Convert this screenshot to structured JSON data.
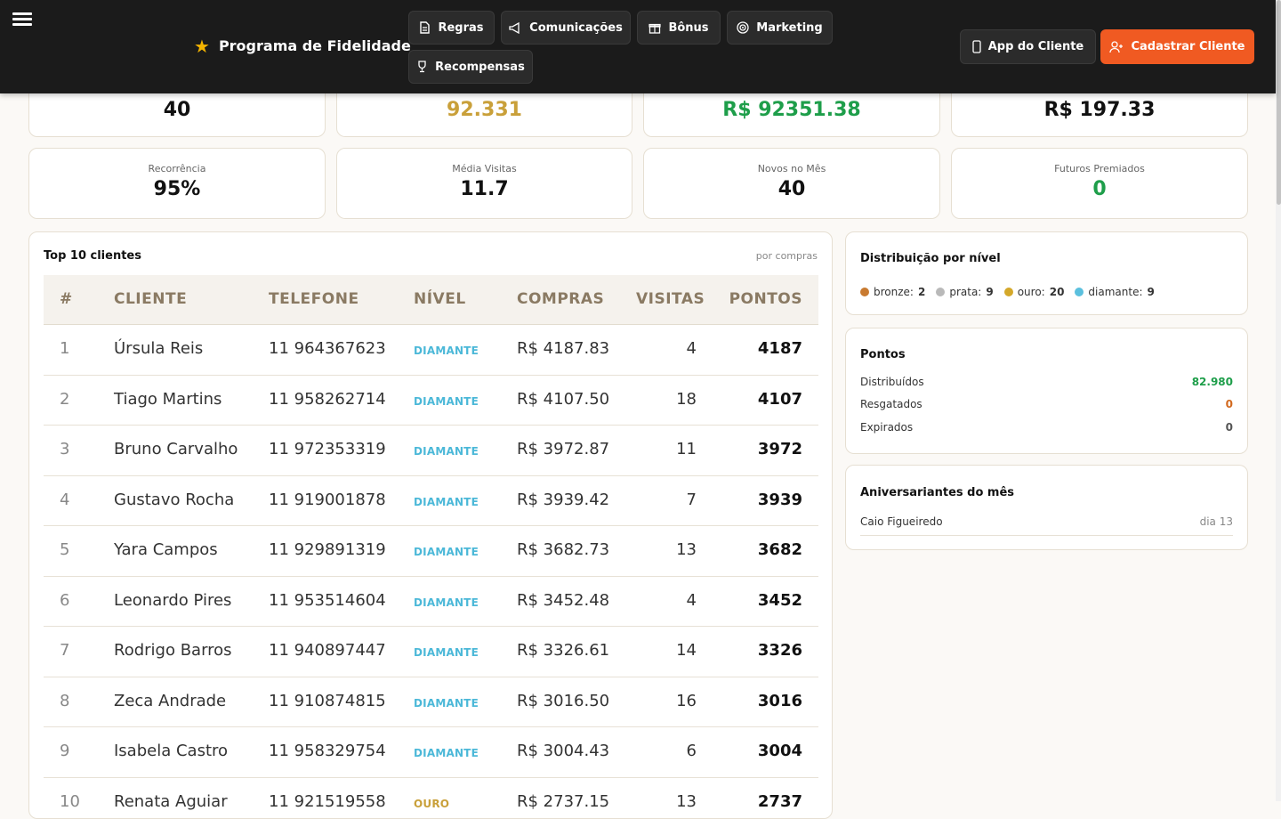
{
  "header": {
    "brand": "Programa de Fidelidade",
    "nav": [
      {
        "label": "Regras",
        "icon": "document-icon"
      },
      {
        "label": "Comunicações",
        "icon": "megaphone-icon"
      },
      {
        "label": "Bônus",
        "icon": "gift-icon"
      },
      {
        "label": "Marketing",
        "icon": "target-icon"
      },
      {
        "label": "Recompensas",
        "icon": "trophy-icon"
      }
    ],
    "app_button": "App do Cliente",
    "cadastrar_button": "Cadastrar Cliente"
  },
  "kpis_top": [
    {
      "value": "40",
      "color": "#111111"
    },
    {
      "value": "92.331",
      "color": "#c9a03a"
    },
    {
      "value": "R$ 92351.38",
      "color": "#1e9e4a"
    },
    {
      "value": "R$ 197.33",
      "color": "#111111"
    }
  ],
  "kpis": [
    {
      "label": "Recorrência",
      "value": "95%",
      "color": "#111111"
    },
    {
      "label": "Média Visitas",
      "value": "11.7",
      "color": "#111111"
    },
    {
      "label": "Novos no Mês",
      "value": "40",
      "color": "#111111"
    },
    {
      "label": "Futuros Premiados",
      "value": "0",
      "color": "#1e9e4a"
    }
  ],
  "top_clients": {
    "title": "Top 10 clientes",
    "subtitle": "por compras",
    "columns": [
      "#",
      "CLIENTE",
      "TELEFONE",
      "NÍVEL",
      "COMPRAS",
      "VISITAS",
      "PONTOS"
    ],
    "rows": [
      {
        "rank": "1",
        "name": "Úrsula Reis",
        "phone": "11 964367623",
        "level": "DIAMANTE",
        "purchases": "R$ 4187.83",
        "visits": "4",
        "points": "4187"
      },
      {
        "rank": "2",
        "name": "Tiago Martins",
        "phone": "11 958262714",
        "level": "DIAMANTE",
        "purchases": "R$ 4107.50",
        "visits": "18",
        "points": "4107"
      },
      {
        "rank": "3",
        "name": "Bruno Carvalho",
        "phone": "11 972353319",
        "level": "DIAMANTE",
        "purchases": "R$ 3972.87",
        "visits": "11",
        "points": "3972"
      },
      {
        "rank": "4",
        "name": "Gustavo Rocha",
        "phone": "11 919001878",
        "level": "DIAMANTE",
        "purchases": "R$ 3939.42",
        "visits": "7",
        "points": "3939"
      },
      {
        "rank": "5",
        "name": "Yara Campos",
        "phone": "11 929891319",
        "level": "DIAMANTE",
        "purchases": "R$ 3682.73",
        "visits": "13",
        "points": "3682"
      },
      {
        "rank": "6",
        "name": "Leonardo Pires",
        "phone": "11 953514604",
        "level": "DIAMANTE",
        "purchases": "R$ 3452.48",
        "visits": "4",
        "points": "3452"
      },
      {
        "rank": "7",
        "name": "Rodrigo Barros",
        "phone": "11 940897447",
        "level": "DIAMANTE",
        "purchases": "R$ 3326.61",
        "visits": "14",
        "points": "3326"
      },
      {
        "rank": "8",
        "name": "Zeca Andrade",
        "phone": "11 910874815",
        "level": "DIAMANTE",
        "purchases": "R$ 3016.50",
        "visits": "16",
        "points": "3016"
      },
      {
        "rank": "9",
        "name": "Isabela Castro",
        "phone": "11 958329754",
        "level": "DIAMANTE",
        "purchases": "R$ 3004.43",
        "visits": "6",
        "points": "3004"
      },
      {
        "rank": "10",
        "name": "Renata Aguiar",
        "phone": "11 921519558",
        "level": "OURO",
        "purchases": "R$ 2737.15",
        "visits": "13",
        "points": "2737"
      }
    ],
    "level_colors": {
      "DIAMANTE": "#4bb8d8",
      "OURO": "#c9a03a"
    }
  },
  "distribution": {
    "title": "Distribuição por nível",
    "items": [
      {
        "label": "bronze:",
        "value": "2",
        "color": "#c87a30"
      },
      {
        "label": "prata:",
        "value": "9",
        "color": "#b9b9b9"
      },
      {
        "label": "ouro:",
        "value": "20",
        "color": "#d4a82a"
      },
      {
        "label": "diamante:",
        "value": "9",
        "color": "#5bc0de"
      }
    ]
  },
  "points": {
    "title": "Pontos",
    "rows": [
      {
        "label": "Distribuídos",
        "value": "82.980",
        "color": "#1e9e4a"
      },
      {
        "label": "Resgatados",
        "value": "0",
        "color": "#d2691e"
      },
      {
        "label": "Expirados",
        "value": "0",
        "color": "#555555"
      }
    ]
  },
  "birthdays": {
    "title": "Aniversariantes do mês",
    "items": [
      {
        "name": "Caio Figueiredo",
        "day": "dia 13"
      }
    ]
  }
}
